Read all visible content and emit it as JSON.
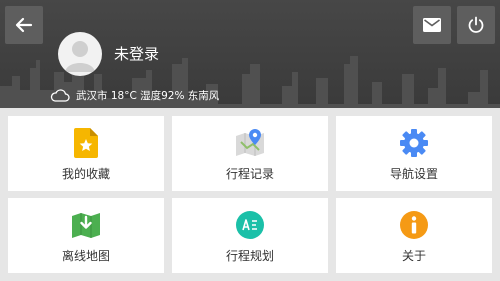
{
  "header": {
    "username": "未登录",
    "weather_text": "武汉市 18°C 湿度92% 东南风"
  },
  "icons": {
    "back": "back-arrow-icon",
    "mail": "mail-icon",
    "power": "power-icon",
    "avatar": "avatar-icon",
    "weather": "cloud-icon"
  },
  "menu": [
    {
      "label": "我的收藏",
      "icon": "favorites-icon",
      "color": "#f6b600"
    },
    {
      "label": "行程记录",
      "icon": "map-pin-icon",
      "color": "#4a8af4"
    },
    {
      "label": "导航设置",
      "icon": "gear-icon",
      "color": "#4a8af4"
    },
    {
      "label": "离线地图",
      "icon": "download-map-icon",
      "color": "#4caf50"
    },
    {
      "label": "行程规划",
      "icon": "route-plan-icon",
      "color": "#1bc0a8"
    },
    {
      "label": "关于",
      "icon": "info-icon",
      "color": "#f59a15"
    }
  ],
  "colors": {
    "header_bg": "#404040",
    "button_bg": "#5e5e5e",
    "tile_bg": "#ffffff",
    "page_bg": "#e6e6e6"
  }
}
